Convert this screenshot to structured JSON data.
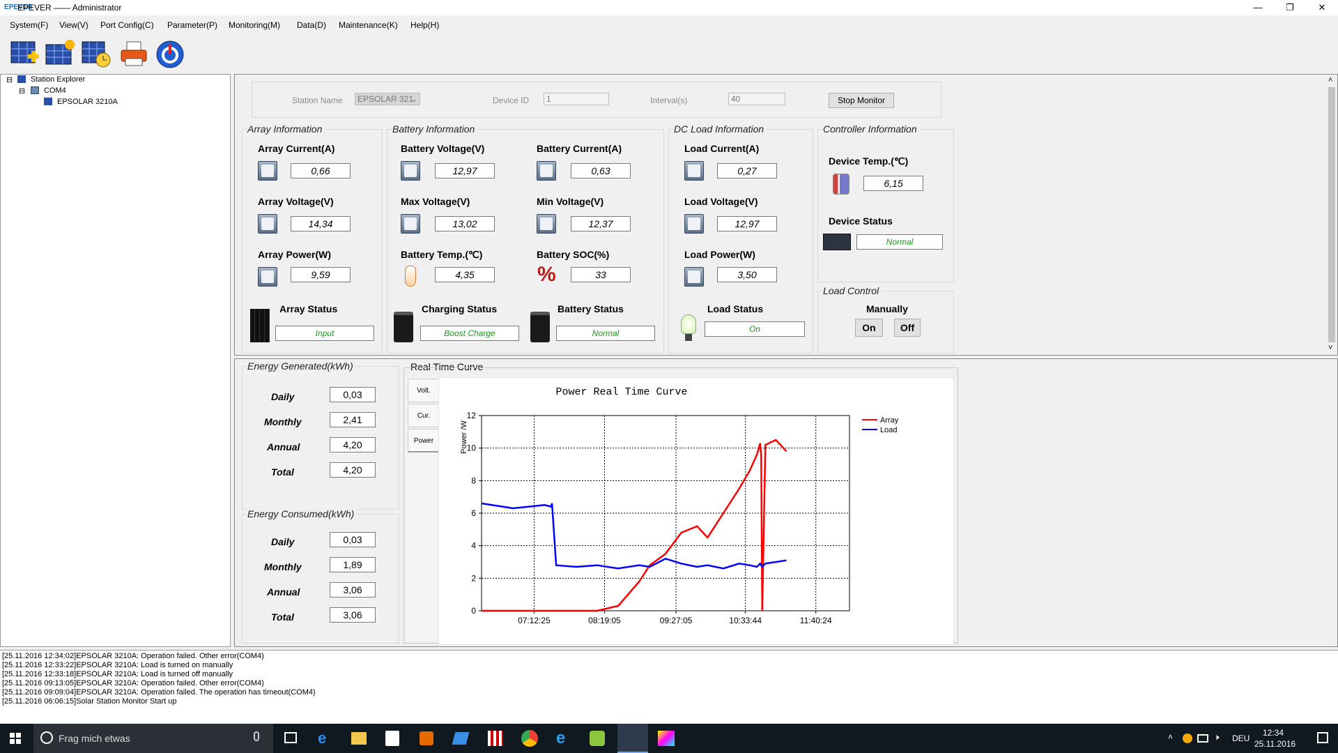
{
  "window": {
    "title": "EPEVER —— Administrator",
    "logo": "EPEVER"
  },
  "menu": [
    "System(F)",
    "View(V)",
    "Port Config(C)",
    "Parameter(P)",
    "Monitoring(M)",
    "Data(D)",
    "Maintenance(K)",
    "Help(H)"
  ],
  "explorer": {
    "root": "Station Explorer",
    "port": "COM4",
    "device": "EPSOLAR 3210A"
  },
  "station": {
    "name_label": "Station Name",
    "name_value": "EPSOLAR 321",
    "device_id_label": "Device ID",
    "device_id_value": "1",
    "interval_label": "Interval(s)",
    "interval_value": "40",
    "stop_button": "Stop Monitor"
  },
  "array": {
    "title": "Array Information",
    "current_label": "Array Current(A)",
    "current": "0,66",
    "voltage_label": "Array Voltage(V)",
    "voltage": "14,34",
    "power_label": "Array Power(W)",
    "power": "9,59",
    "status_label": "Array Status",
    "status": "Input"
  },
  "battery": {
    "title": "Battery Information",
    "voltage_label": "Battery Voltage(V)",
    "voltage": "12,97",
    "current_label": "Battery Current(A)",
    "current": "0,63",
    "max_label": "Max Voltage(V)",
    "max": "13,02",
    "min_label": "Min Voltage(V)",
    "min": "12,37",
    "temp_label": "Battery Temp.(℃)",
    "temp": "4,35",
    "soc_label": "Battery SOC(%)",
    "soc": "33",
    "charging_label": "Charging Status",
    "charging": "Boost Charge",
    "status_label": "Battery Status",
    "status": "Normal"
  },
  "load": {
    "title": "DC Load Information",
    "current_label": "Load Current(A)",
    "current": "0,27",
    "voltage_label": "Load Voltage(V)",
    "voltage": "12,97",
    "power_label": "Load Power(W)",
    "power": "3,50",
    "status_label": "Load Status",
    "status": "On"
  },
  "controller": {
    "title": "Controller Information",
    "temp_label": "Device Temp.(℃)",
    "temp": "6,15",
    "status_label": "Device Status",
    "status": "Normal"
  },
  "load_control": {
    "title": "Load Control",
    "mode": "Manually",
    "on": "On",
    "off": "Off"
  },
  "energy_generated": {
    "title": "Energy Generated(kWh)",
    "daily_label": "Daily",
    "daily": "0,03",
    "monthly_label": "Monthly",
    "monthly": "2,41",
    "annual_label": "Annual",
    "annual": "4,20",
    "total_label": "Total",
    "total": "4,20"
  },
  "energy_consumed": {
    "title": "Energy Consumed(kWh)",
    "daily_label": "Daily",
    "daily": "0,03",
    "monthly_label": "Monthly",
    "monthly": "1,89",
    "annual_label": "Annual",
    "annual": "3,06",
    "total_label": "Total",
    "total": "3,06"
  },
  "curve": {
    "title": "Real Time Curve",
    "tabs": [
      "Volt.",
      "Cur.",
      "Power"
    ]
  },
  "chart_data": {
    "type": "line",
    "title": "Power Real Time Curve",
    "ylabel": "Power /W",
    "xlabel": "",
    "ylim": [
      0,
      12
    ],
    "yticks": [
      0,
      2,
      4,
      6,
      8,
      10,
      12
    ],
    "xticks": [
      "07:12:25",
      "08:19:05",
      "09:27:05",
      "10:33:44",
      "11:40:24"
    ],
    "x_minutes": [
      0,
      30,
      60,
      66,
      67,
      71,
      90,
      110,
      130,
      150,
      160,
      175,
      190,
      205,
      215,
      230,
      245,
      255,
      262,
      265,
      266,
      267,
      270,
      280,
      290
    ],
    "x_minute_ticks": [
      50,
      117,
      185,
      251,
      318
    ],
    "grid": true,
    "legend": "top-right",
    "colors": {
      "Array": "#ff0000",
      "Load": "#0000ff"
    },
    "series": [
      {
        "name": "Array",
        "values": [
          0,
          0,
          0,
          0,
          0,
          0,
          0,
          0,
          0.3,
          1.8,
          2.8,
          3.5,
          4.8,
          5.2,
          4.5,
          6.0,
          7.5,
          8.6,
          9.6,
          10.3,
          9.5,
          0,
          10.2,
          10.5,
          9.8
        ]
      },
      {
        "name": "Load",
        "values": [
          6.6,
          6.3,
          6.5,
          6.4,
          6.6,
          2.8,
          2.7,
          2.8,
          2.6,
          2.8,
          2.7,
          3.2,
          2.9,
          2.7,
          2.8,
          2.6,
          2.9,
          2.8,
          2.7,
          2.9,
          2.8,
          2.7,
          2.9,
          3.0,
          3.1
        ]
      }
    ]
  },
  "log": [
    "[25.11.2016 12:34:02]EPSOLAR 3210A: Operation failed. Other error(COM4)",
    "[25.11.2016 12:33:22]EPSOLAR 3210A: Load is turned on manually",
    "[25.11.2016 12:33:18]EPSOLAR 3210A: Load is turned off manually",
    "[25.11.2016 09:13:05]EPSOLAR 3210A: Operation failed. Other error(COM4)",
    "[25.11.2016 09:09:04]EPSOLAR 3210A: Operation failed. The operation has timeout(COM4)",
    "[25.11.2016 06:06:15]Solar Station Monitor Start up"
  ],
  "taskbar": {
    "search": "Frag mich etwas",
    "lang": "DEU",
    "time": "12:34",
    "date": "25.11.2016"
  }
}
